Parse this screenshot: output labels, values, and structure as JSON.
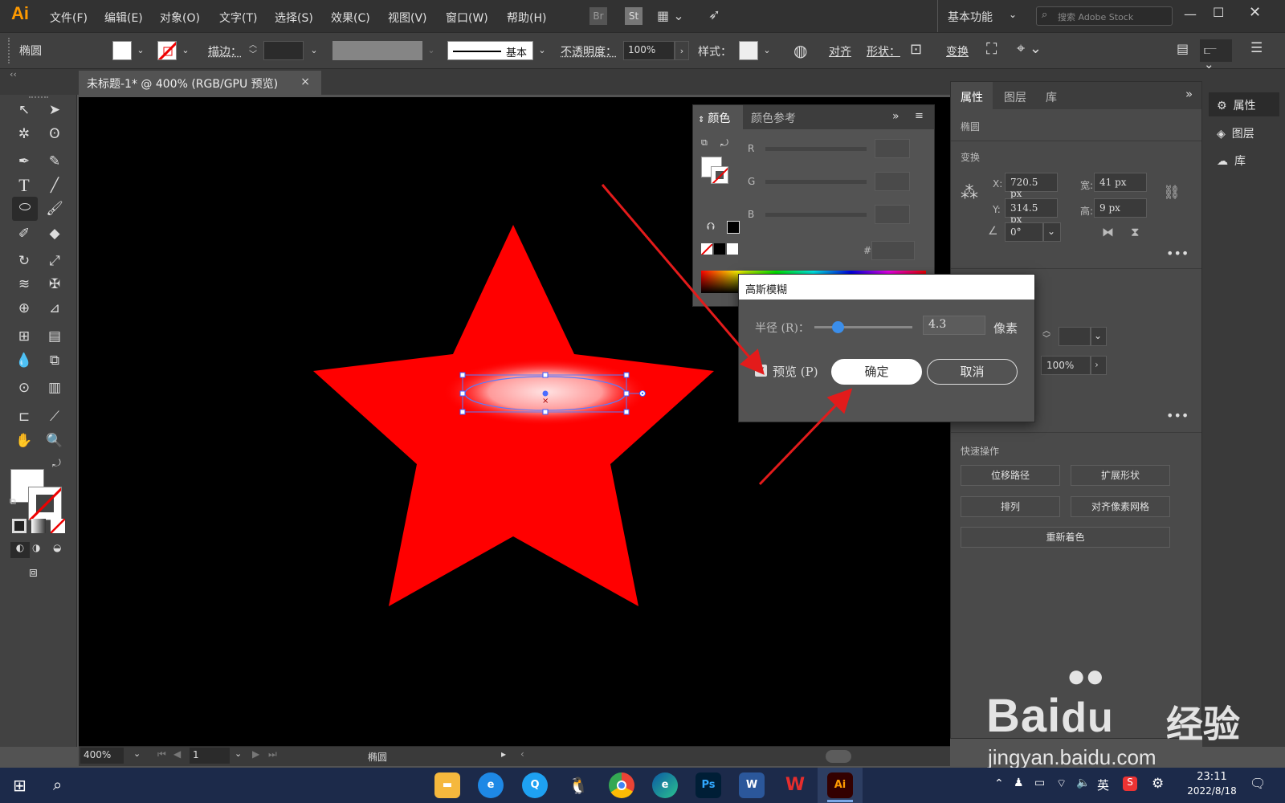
{
  "app": {
    "logo": "Ai"
  },
  "menu": [
    "文件(F)",
    "编辑(E)",
    "对象(O)",
    "文字(T)",
    "选择(S)",
    "效果(C)",
    "视图(V)",
    "窗口(W)",
    "帮助(H)"
  ],
  "topbar": {
    "br": "Br",
    "st": "St",
    "workspace": "基本功能",
    "search_placeholder": "搜索 Adobe Stock"
  },
  "control": {
    "object": "椭圆",
    "stroke": "描边：",
    "stroke_style": "基本",
    "opacity_label": "不透明度：",
    "opacity": "100%",
    "style_label": "样式：",
    "align": "对齐",
    "shape": "形状：",
    "transform": "变换"
  },
  "document": {
    "tab": "未标题-1* @ 400% (RGB/GPU 预览)",
    "close": "×"
  },
  "status": {
    "zoom": "400%",
    "page": "1",
    "selection": "椭圆"
  },
  "color_panel": {
    "tabs": [
      "颜色",
      "颜色参考"
    ],
    "channels": [
      "R",
      "G",
      "B"
    ],
    "hash": "#"
  },
  "properties": {
    "tabs": [
      "属性",
      "图层",
      "库"
    ],
    "object": "椭圆",
    "section_transform": "变换",
    "x_label": "X:",
    "x": "720.5 px",
    "y_label": "Y:",
    "y": "314.5 px",
    "w_label": "宽:",
    "w": "41 px",
    "h_label": "高:",
    "h": "9 px",
    "angle": "0°",
    "opacity": "100%",
    "quick_actions": "快速操作",
    "buttons": [
      "位移路径",
      "扩展形状",
      "排列",
      "对齐像素网格",
      "重新着色"
    ]
  },
  "dock": [
    "属性",
    "图层",
    "库"
  ],
  "dialog": {
    "title": "高斯模糊",
    "radius_label": "半径 (R)：",
    "radius": "4.3",
    "unit": "像素",
    "preview": "预览 (P)",
    "preview_checked": true,
    "ok": "确定",
    "cancel": "取消",
    "radius_slider_fraction": 0.24
  },
  "taskbar": {
    "apps": [
      "file-explorer",
      "edge-legacy",
      "qq-browser",
      "qq",
      "chrome",
      "edge",
      "Ps",
      "W",
      "wps",
      "Ai"
    ],
    "ime": "英",
    "time": "23:11",
    "date": "2022/8/18"
  },
  "watermark": {
    "brand": "Bai",
    "brand2": "du",
    "brand_cn": "经验",
    "url": "jingyan.baidu.com"
  },
  "colors": {
    "star": "#ff0000",
    "accent": "#3b8eea",
    "annotation": "#e31b1b"
  }
}
